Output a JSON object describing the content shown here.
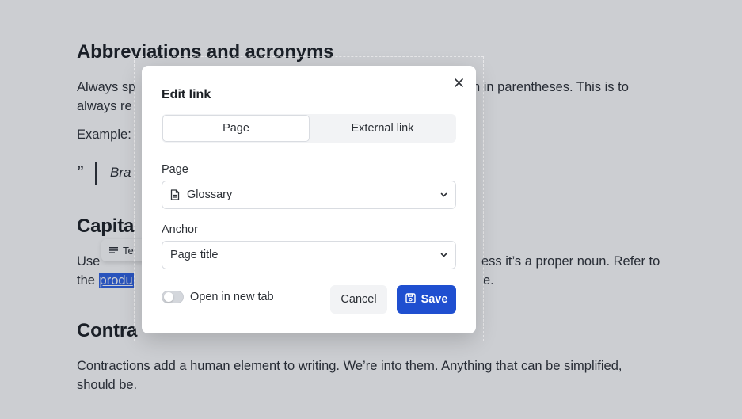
{
  "document": {
    "heading1": "Abbreviations and acronyms",
    "para1_line1": "Always sp",
    "para1_line1_right": "n in parentheses. This is to",
    "para1_line2": "always re",
    "example_label": "Example:",
    "quote_text": "Bra",
    "heading2": "Capita",
    "para2_line1_left": "Use",
    "para2_line1_right": "ess it’s a proper noun. Refer to",
    "para2_line2_left": "the",
    "para2_highlight": "produ",
    "para2_line2_right": "e.",
    "chip_text": "Te",
    "heading3": "Contra",
    "para3_line1": "Contractions add a human element to writing. We’re into them. Anything that can be simplified,",
    "para3_line2": "should be."
  },
  "modal": {
    "title": "Edit link",
    "tabs": [
      {
        "label": "Page",
        "active": true
      },
      {
        "label": "External link",
        "active": false
      }
    ],
    "page_field": {
      "label": "Page",
      "value": "Glossary",
      "icon": "document-icon"
    },
    "anchor_field": {
      "label": "Anchor",
      "value": "Page title"
    },
    "open_new_tab": {
      "label": "Open in new tab",
      "checked": false
    },
    "cancel_label": "Cancel",
    "save_label": "Save",
    "save_icon": "save-icon",
    "close_icon": "close-icon"
  },
  "colors": {
    "accent": "#1f4fd0",
    "highlight": "#2f62e3",
    "overlay": "rgba(25,32,48,0.22)"
  }
}
